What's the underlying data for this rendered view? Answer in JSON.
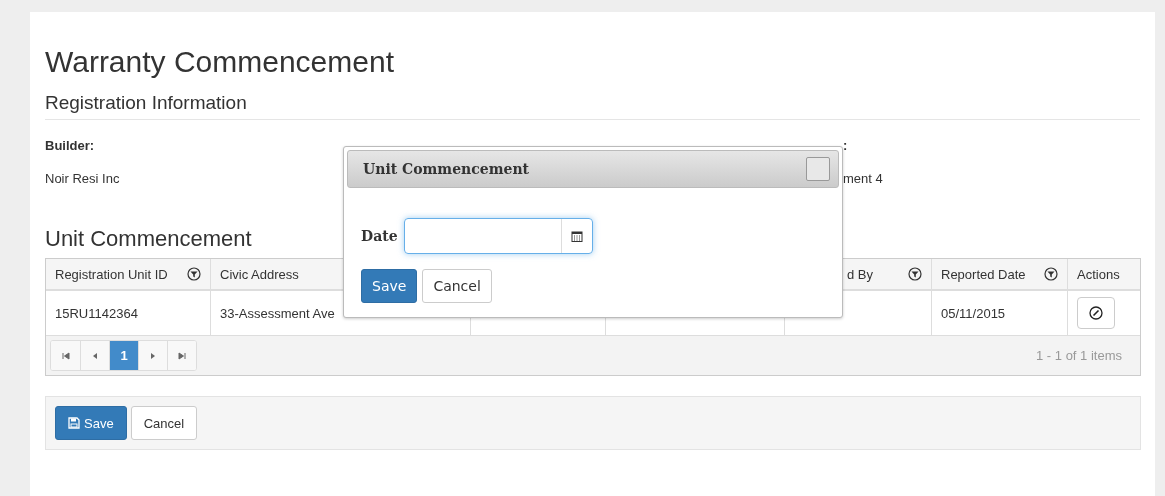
{
  "page_title": "Warranty Commencement",
  "section_title": "Registration Information",
  "registration_fields": [
    {
      "label": "Builder:",
      "value": "Noir Resi Inc"
    },
    {
      "label": ":",
      "value": "ment 4"
    }
  ],
  "grid_title": "Unit Commencement",
  "table": {
    "columns": [
      {
        "label": "Registration Unit ID",
        "filter": true
      },
      {
        "label": "Civic Address"
      },
      {},
      {},
      {
        "label": "d By",
        "filter": true
      },
      {
        "label": "Reported Date",
        "filter": true
      },
      {
        "label": "Actions",
        "filter": false
      }
    ],
    "rows": [
      {
        "cells": [
          "15RU1142364",
          "33-Assessment Ave",
          "",
          "",
          "",
          "05/11/2015"
        ]
      }
    ],
    "pager": {
      "pages": [
        {
          "label": "1",
          "selected": true
        }
      ],
      "summary": "1 - 1 of 1 items"
    }
  },
  "footer_buttons": [
    {
      "label": "Save",
      "kind": "primary"
    },
    {
      "label": "Cancel",
      "kind": "default"
    }
  ],
  "dialog": {
    "title": "Unit Commencement",
    "field_label": "Date",
    "buttons": [
      {
        "label": "Save",
        "kind": "primary"
      },
      {
        "label": "Cancel",
        "kind": "default"
      }
    ]
  }
}
